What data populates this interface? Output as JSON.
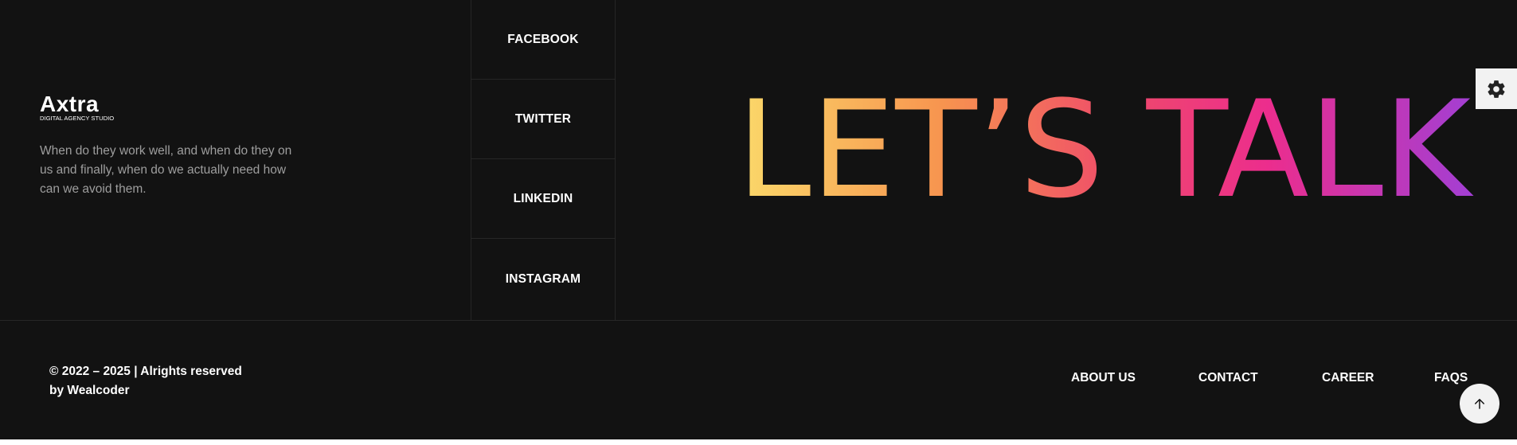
{
  "brand": {
    "logo_text": "Axtra",
    "logo_subtitle": "DIGITAL AGENCY STUDIO",
    "description": "When do they work well, and when do they on us and finally, when do we actually need how can we avoid them."
  },
  "social": [
    {
      "label": "FACEBOOK"
    },
    {
      "label": "TWITTER"
    },
    {
      "label": "LINKEDIN"
    },
    {
      "label": "INSTAGRAM"
    }
  ],
  "cta": {
    "text": "LET’S TALK",
    "gradient": [
      "#fbd96a",
      "#f7944f",
      "#ef4a6a",
      "#ec2d8d",
      "#a23fd4"
    ]
  },
  "settings": {
    "icon": "gear-icon"
  },
  "copyright": {
    "line1": "© 2022 – 2025 | Alrights reserved",
    "line2": "by Wealcoder"
  },
  "menu": [
    {
      "label": "ABOUT US"
    },
    {
      "label": "CONTACT"
    },
    {
      "label": "CAREER"
    },
    {
      "label": "FAQS"
    }
  ],
  "scroll_top": {
    "icon": "arrow-up-icon"
  }
}
